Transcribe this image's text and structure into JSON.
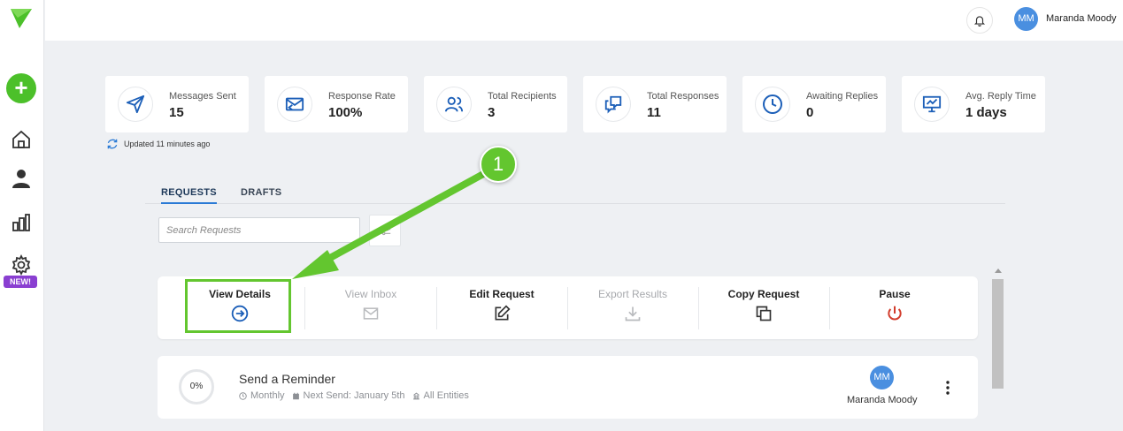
{
  "brand": {
    "logo_icon": "paper-plane-logo-icon",
    "accent": "#4cc02a"
  },
  "sidebar": {
    "add_icon": "+",
    "items": [
      {
        "name": "home",
        "icon": "home-icon"
      },
      {
        "name": "contacts",
        "icon": "user-icon"
      },
      {
        "name": "reports",
        "icon": "bar-chart-icon"
      },
      {
        "name": "settings",
        "icon": "gear-icon"
      }
    ],
    "new_badge": "NEW!"
  },
  "topbar": {
    "user_initials": "MM",
    "user_name": "Maranda Moody"
  },
  "stats": [
    {
      "label": "Messages Sent",
      "value": "15",
      "icon": "send-icon"
    },
    {
      "label": "Response Rate",
      "value": "100%",
      "icon": "mail-reply-icon"
    },
    {
      "label": "Total Recipients",
      "value": "3",
      "icon": "users-icon"
    },
    {
      "label": "Total Responses",
      "value": "11",
      "icon": "chat-icon"
    },
    {
      "label": "Awaiting Replies",
      "value": "0",
      "icon": "clock-icon"
    },
    {
      "label": "Avg. Reply Time",
      "value": "1 days",
      "icon": "monitor-icon"
    }
  ],
  "updated_text": "Updated 11 minutes ago",
  "tabs": [
    {
      "label": "REQUESTS",
      "active": true
    },
    {
      "label": "DRAFTS",
      "active": false
    }
  ],
  "search": {
    "placeholder": "Search Requests"
  },
  "actions": [
    {
      "label": "View Details",
      "icon": "arrow-right-circle-icon",
      "enabled": true
    },
    {
      "label": "View Inbox",
      "icon": "mail-icon",
      "enabled": false
    },
    {
      "label": "Edit Request",
      "icon": "edit-icon",
      "enabled": true
    },
    {
      "label": "Export Results",
      "icon": "download-icon",
      "enabled": false
    },
    {
      "label": "Copy Request",
      "icon": "copy-icon",
      "enabled": true
    },
    {
      "label": "Pause",
      "icon": "power-icon",
      "enabled": true
    }
  ],
  "request_row": {
    "progress": "0%",
    "title": "Send a Reminder",
    "frequency": "Monthly",
    "next_send": "Next Send: January 5th",
    "entities": "All Entities",
    "owner_initials": "MM",
    "owner_name": "Maranda Moody"
  },
  "callout": {
    "number": "1",
    "color": "#63c62f"
  }
}
